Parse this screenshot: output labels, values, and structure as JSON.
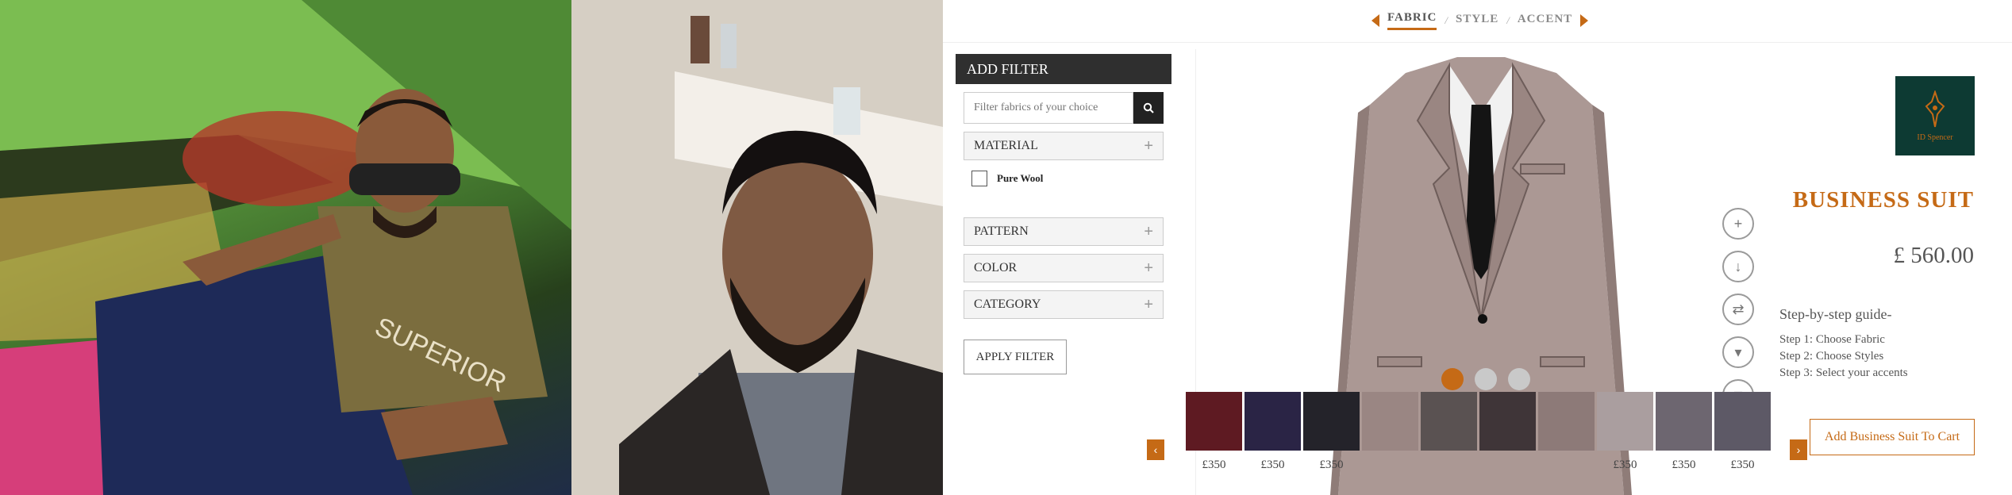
{
  "photos": [
    {
      "name": "camping-tent-photo"
    },
    {
      "name": "selfie-photo"
    }
  ],
  "steps": {
    "items": [
      {
        "label": "FABRIC",
        "active": true
      },
      {
        "label": "STYLE",
        "active": false
      },
      {
        "label": "ACCENT",
        "active": false
      }
    ],
    "separator": "/"
  },
  "filter": {
    "title": "ADD FILTER",
    "search_placeholder": "Filter fabrics of your choice",
    "sections": [
      {
        "label": "MATERIAL",
        "expand": "+"
      },
      {
        "label": "PATTERN",
        "expand": "+"
      },
      {
        "label": "COLOR",
        "expand": "+"
      },
      {
        "label": "CATEGORY",
        "expand": "+"
      }
    ],
    "material_option": "Pure Wool",
    "apply_label": "APPLY FILTER"
  },
  "product": {
    "brand": "ID Spencer",
    "title": "BUSINESS SUIT",
    "price": "£ 560.00",
    "guide_title": "Step-by-step guide-",
    "guide_steps": [
      "Step 1: Choose Fabric",
      "Step 2: Choose Styles",
      "Step 3: Select your accents"
    ],
    "cart_label": "Add Business Suit To Cart"
  },
  "view_controls": [
    "zoom-in-icon",
    "download-icon",
    "compare-icon",
    "tie-icon",
    "lock-icon"
  ],
  "fabrics": [
    {
      "price": "£350",
      "color": "#5e1a22"
    },
    {
      "price": "£350",
      "color": "#2a2445"
    },
    {
      "price": "£350",
      "color": "#24232a"
    },
    {
      "price": "",
      "color": "#9a8683"
    },
    {
      "price": "",
      "color": "#5a5252"
    },
    {
      "price": "",
      "color": "#3f3538"
    },
    {
      "price": "",
      "color": "#8d7a78"
    },
    {
      "price": "£350",
      "color": "#aa9e9f"
    },
    {
      "price": "£350",
      "color": "#6d6670"
    },
    {
      "price": "£350",
      "color": "#5d5966"
    }
  ],
  "colors": {
    "accent": "#c56a16",
    "brand_bg": "#0d3a33",
    "header": "#2f2f2f"
  }
}
